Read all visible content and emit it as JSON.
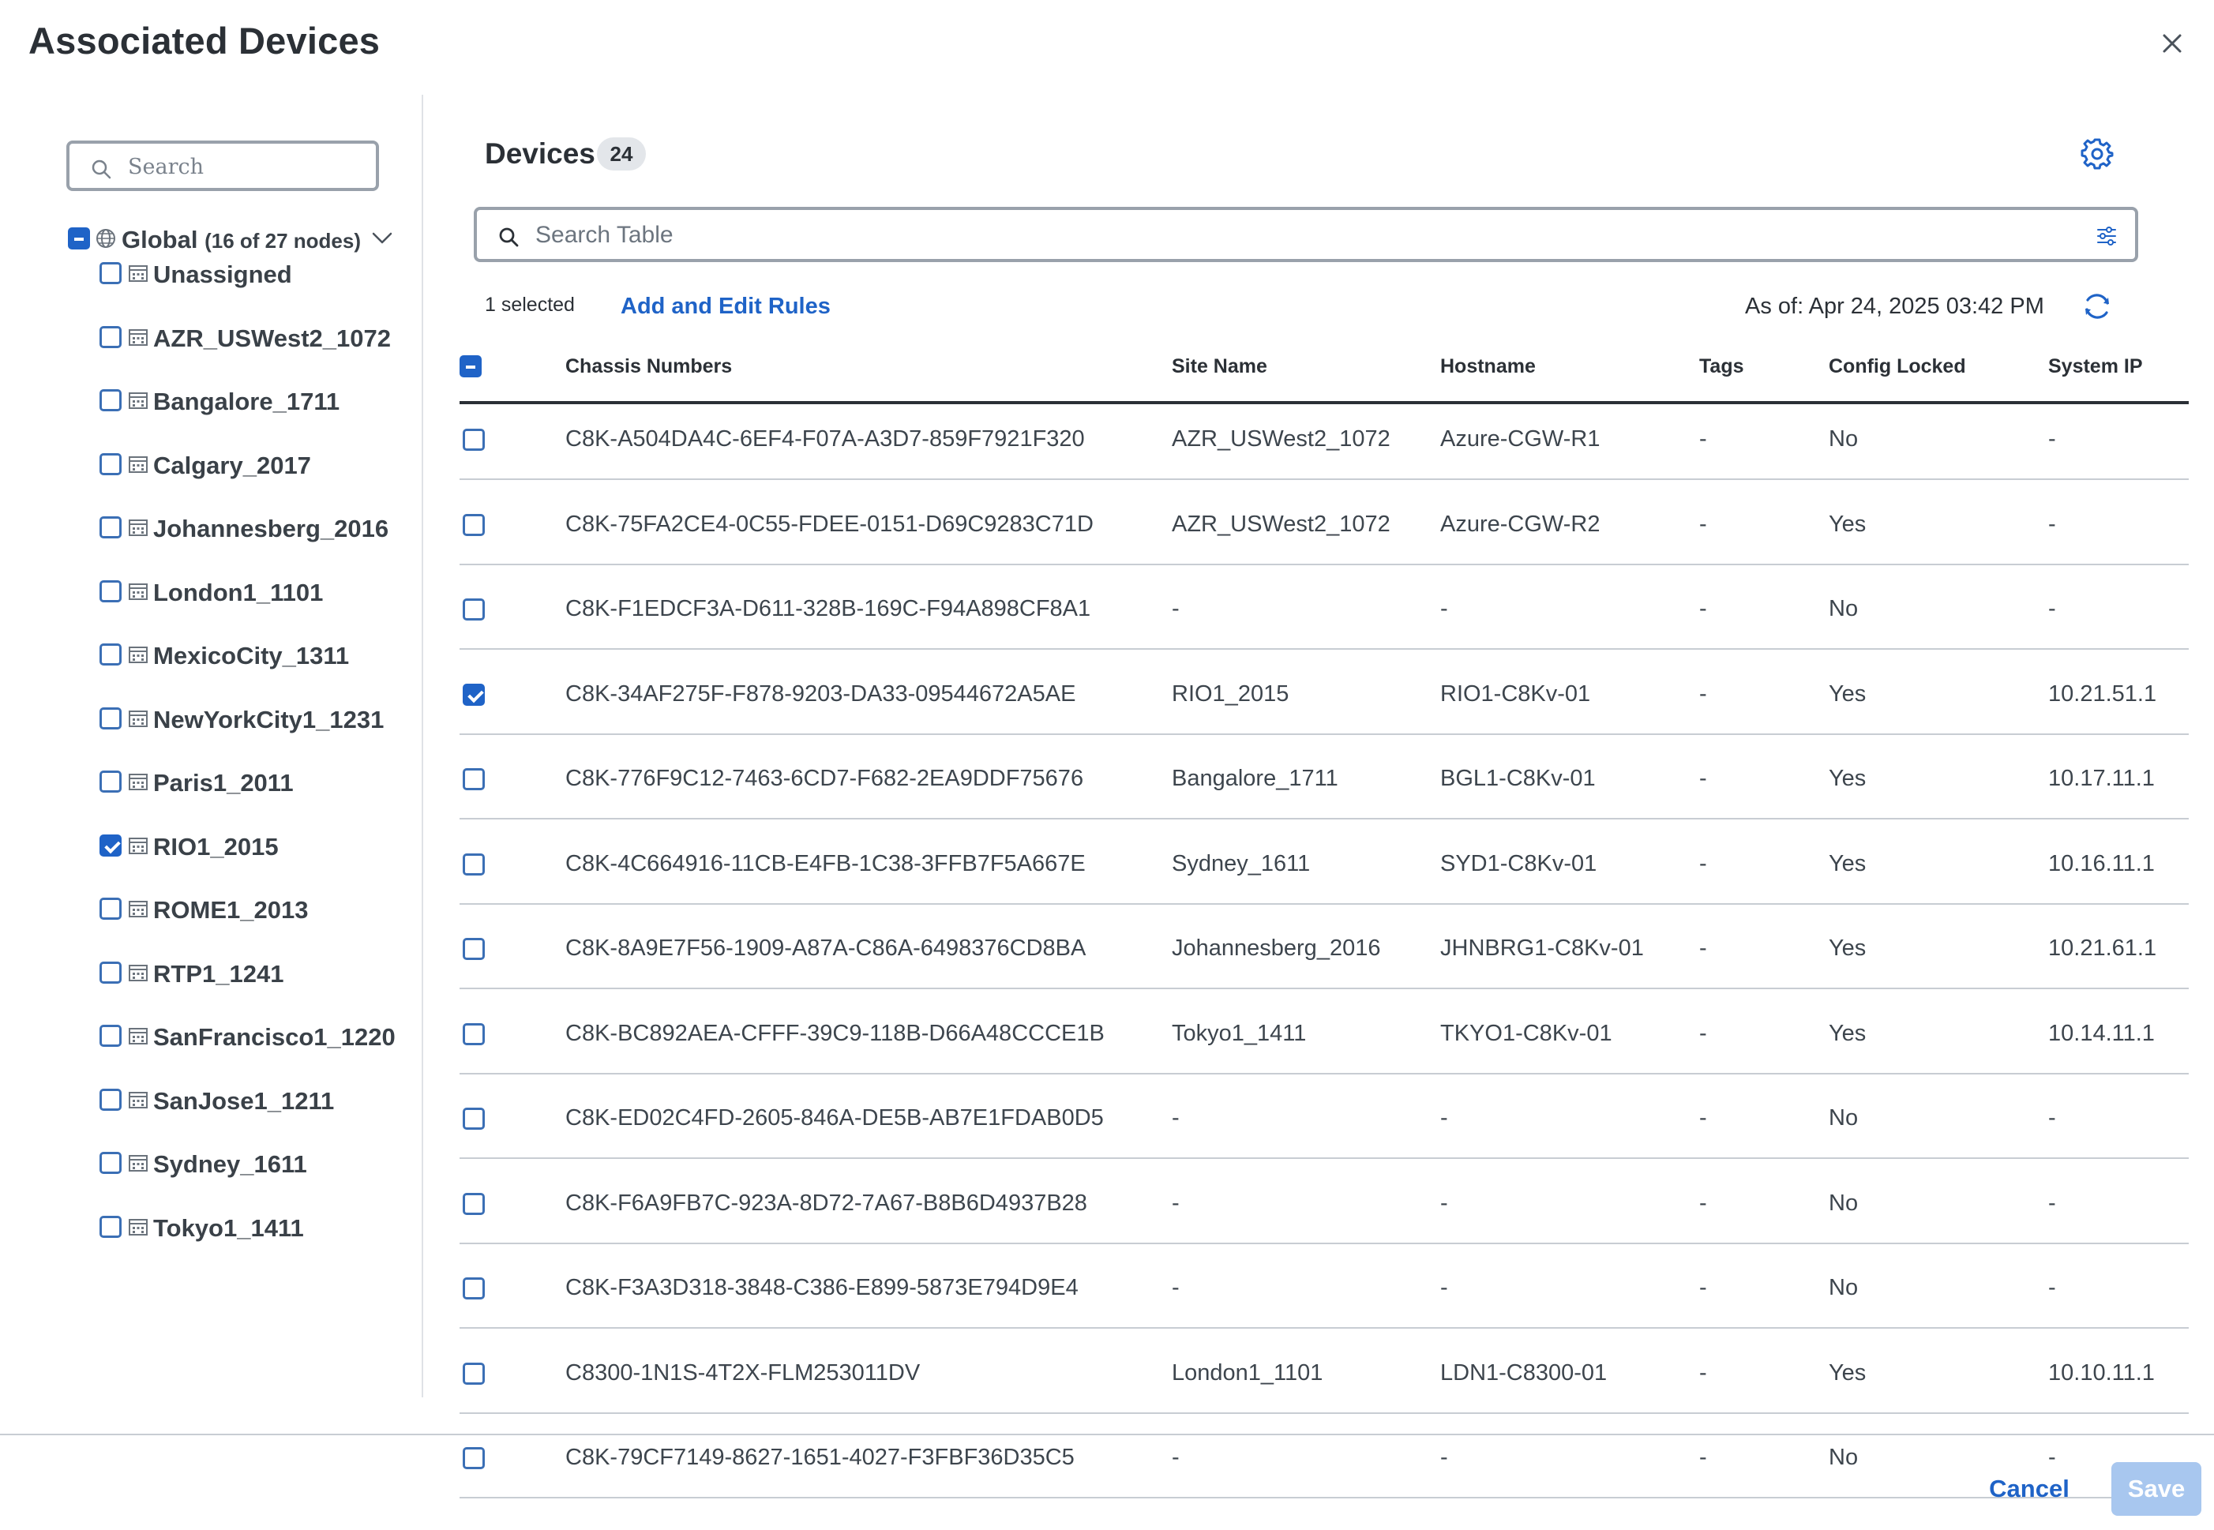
{
  "dialog": {
    "title": "Associated Devices"
  },
  "tree": {
    "search_placeholder": "Search",
    "root": {
      "label": "Global",
      "count": "(16 of 27 nodes)",
      "state": "partial"
    },
    "sites": [
      {
        "label": "Unassigned",
        "checked": false
      },
      {
        "label": "AZR_USWest2_1072",
        "checked": false
      },
      {
        "label": "Bangalore_1711",
        "checked": false
      },
      {
        "label": "Calgary_2017",
        "checked": false
      },
      {
        "label": "Johannesberg_2016",
        "checked": false
      },
      {
        "label": "London1_1101",
        "checked": false
      },
      {
        "label": "MexicoCity_1311",
        "checked": false
      },
      {
        "label": "NewYorkCity1_1231",
        "checked": false
      },
      {
        "label": "Paris1_2011",
        "checked": false
      },
      {
        "label": "RIO1_2015",
        "checked": true
      },
      {
        "label": "ROME1_2013",
        "checked": false
      },
      {
        "label": "RTP1_1241",
        "checked": false
      },
      {
        "label": "SanFrancisco1_1220",
        "checked": false
      },
      {
        "label": "SanJose1_1211",
        "checked": false
      },
      {
        "label": "Sydney_1611",
        "checked": false
      },
      {
        "label": "Tokyo1_1411",
        "checked": false
      }
    ]
  },
  "devices": {
    "title": "Devices",
    "count": "24",
    "search_placeholder": "Search Table",
    "selected_text": "1 selected",
    "rules_link": "Add and Edit Rules",
    "as_of": "As of: Apr 24, 2025 03:42 PM",
    "columns": {
      "chassis": "Chassis Numbers",
      "site": "Site Name",
      "host": "Hostname",
      "tags": "Tags",
      "lock": "Config Locked",
      "ip": "System IP"
    },
    "rows": [
      {
        "checked": false,
        "chassis": "C8K-A504DA4C-6EF4-F07A-A3D7-859F7921F320",
        "site": "AZR_USWest2_1072",
        "host": "Azure-CGW-R1",
        "tags": "-",
        "lock": "No",
        "ip": "-"
      },
      {
        "checked": false,
        "chassis": "C8K-75FA2CE4-0C55-FDEE-0151-D69C9283C71D",
        "site": "AZR_USWest2_1072",
        "host": "Azure-CGW-R2",
        "tags": "-",
        "lock": "Yes",
        "ip": "-"
      },
      {
        "checked": false,
        "chassis": "C8K-F1EDCF3A-D611-328B-169C-F94A898CF8A1",
        "site": "-",
        "host": "-",
        "tags": "-",
        "lock": "No",
        "ip": "-"
      },
      {
        "checked": true,
        "chassis": "C8K-34AF275F-F878-9203-DA33-09544672A5AE",
        "site": "RIO1_2015",
        "host": "RIO1-C8Kv-01",
        "tags": "-",
        "lock": "Yes",
        "ip": "10.21.51.1"
      },
      {
        "checked": false,
        "chassis": "C8K-776F9C12-7463-6CD7-F682-2EA9DDF75676",
        "site": "Bangalore_1711",
        "host": "BGL1-C8Kv-01",
        "tags": "-",
        "lock": "Yes",
        "ip": "10.17.11.1"
      },
      {
        "checked": false,
        "chassis": "C8K-4C664916-11CB-E4FB-1C38-3FFB7F5A667E",
        "site": "Sydney_1611",
        "host": "SYD1-C8Kv-01",
        "tags": "-",
        "lock": "Yes",
        "ip": "10.16.11.1"
      },
      {
        "checked": false,
        "chassis": "C8K-8A9E7F56-1909-A87A-C86A-6498376CD8BA",
        "site": "Johannesberg_2016",
        "host": "JHNBRG1-C8Kv-01",
        "tags": "-",
        "lock": "Yes",
        "ip": "10.21.61.1"
      },
      {
        "checked": false,
        "chassis": "C8K-BC892AEA-CFFF-39C9-118B-D66A48CCCE1B",
        "site": "Tokyo1_1411",
        "host": "TKYO1-C8Kv-01",
        "tags": "-",
        "lock": "Yes",
        "ip": "10.14.11.1"
      },
      {
        "checked": false,
        "chassis": "C8K-ED02C4FD-2605-846A-DE5B-AB7E1FDAB0D5",
        "site": "-",
        "host": "-",
        "tags": "-",
        "lock": "No",
        "ip": "-"
      },
      {
        "checked": false,
        "chassis": "C8K-F6A9FB7C-923A-8D72-7A67-B8B6D4937B28",
        "site": "-",
        "host": "-",
        "tags": "-",
        "lock": "No",
        "ip": "-"
      },
      {
        "checked": false,
        "chassis": "C8K-F3A3D318-3848-C386-E899-5873E794D9E4",
        "site": "-",
        "host": "-",
        "tags": "-",
        "lock": "No",
        "ip": "-"
      },
      {
        "checked": false,
        "chassis": "C8300-1N1S-4T2X-FLM253011DV",
        "site": "London1_1101",
        "host": "LDN1-C8300-01",
        "tags": "-",
        "lock": "Yes",
        "ip": "10.10.11.1"
      },
      {
        "checked": false,
        "chassis": "C8K-79CF7149-8627-1651-4027-F3FBF36D35C5",
        "site": "-",
        "host": "-",
        "tags": "-",
        "lock": "No",
        "ip": "-"
      }
    ]
  },
  "footer": {
    "cancel_label": "Cancel",
    "save_label": "Save"
  },
  "colors": {
    "accent": "#1f63c7",
    "save_disabled": "#a8c7ef",
    "text": "#2b3036"
  },
  "icons": {
    "close": "close-icon",
    "search": "search-icon",
    "globe": "globe-icon",
    "building": "building-icon",
    "gear": "gear-icon",
    "filter": "filter-icon",
    "refresh": "refresh-icon",
    "chevron": "chevron-down-icon"
  }
}
